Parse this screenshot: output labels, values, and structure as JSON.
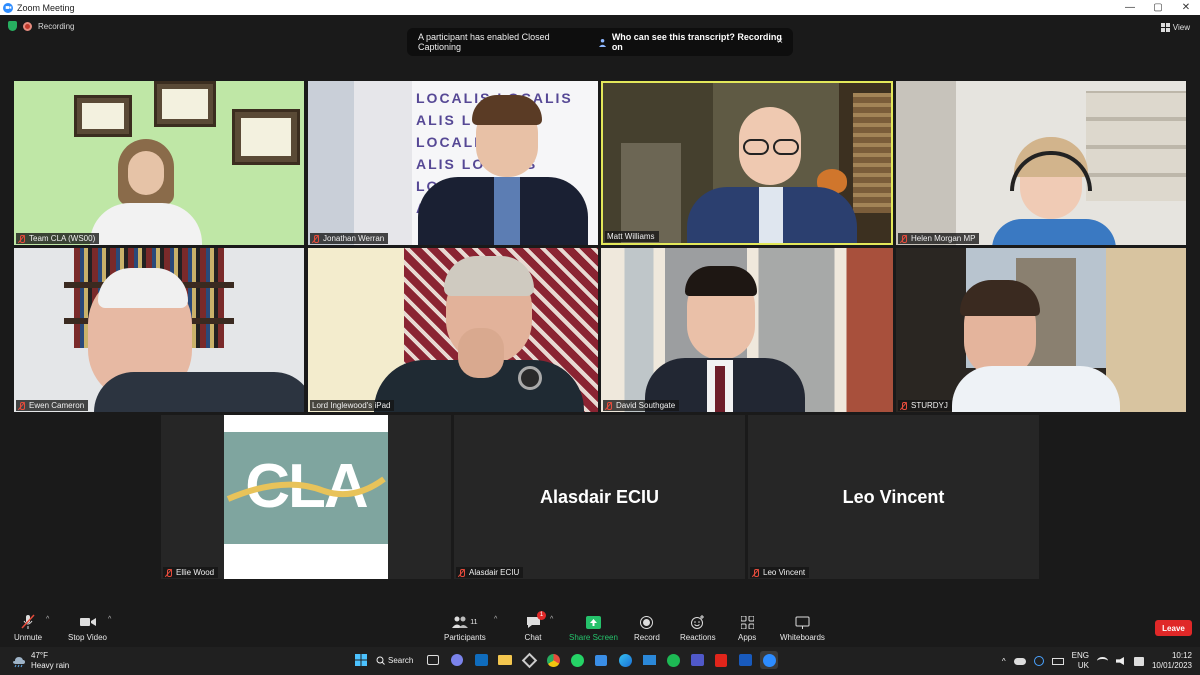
{
  "window": {
    "title": "Zoom Meeting",
    "controls": [
      "—",
      "▢",
      "✕"
    ]
  },
  "status": {
    "recording_label": "Recording",
    "view_label": "View"
  },
  "notice": {
    "text": "A participant has enabled Closed Captioning",
    "link": "Who can see this transcript? Recording on",
    "close": "×"
  },
  "tiles": [
    {
      "name": "Team CLA (WS00)",
      "muted": true
    },
    {
      "name": "Jonathan Werran",
      "muted": true
    },
    {
      "name": "Matt Williams",
      "muted": false,
      "active_speaker": true
    },
    {
      "name": "Helen Morgan MP",
      "muted": true
    },
    {
      "name": "Ewen Cameron",
      "muted": true
    },
    {
      "name": "Lord Inglewood's iPad",
      "muted": false
    },
    {
      "name": "David Southgate",
      "muted": true
    },
    {
      "name": "STURDYJ",
      "muted": true
    },
    {
      "name": "Ellie Wood",
      "muted": true,
      "logo_text": "CLA"
    },
    {
      "name": "Alasdair ECIU",
      "muted": true,
      "display": "Alasdair ECIU"
    },
    {
      "name": "Leo Vincent",
      "muted": true,
      "display": "Leo Vincent"
    }
  ],
  "toolbar": {
    "unmute": "Unmute",
    "stop_video": "Stop Video",
    "participants": "Participants",
    "participants_count": "11",
    "chat": "Chat",
    "chat_badge": "1",
    "share_screen": "Share Screen",
    "record": "Record",
    "reactions": "Reactions",
    "apps": "Apps",
    "whiteboards": "Whiteboards",
    "leave": "Leave"
  },
  "taskbar": {
    "temp": "47°F",
    "weather": "Heavy rain",
    "search": "Search",
    "lang1": "ENG",
    "lang2": "UK",
    "time": "10:12",
    "date": "10/01/2023"
  },
  "colors": {
    "active_speaker_border": "#e3e85a",
    "leave": "#e02828",
    "share_screen": "#25c26b"
  }
}
